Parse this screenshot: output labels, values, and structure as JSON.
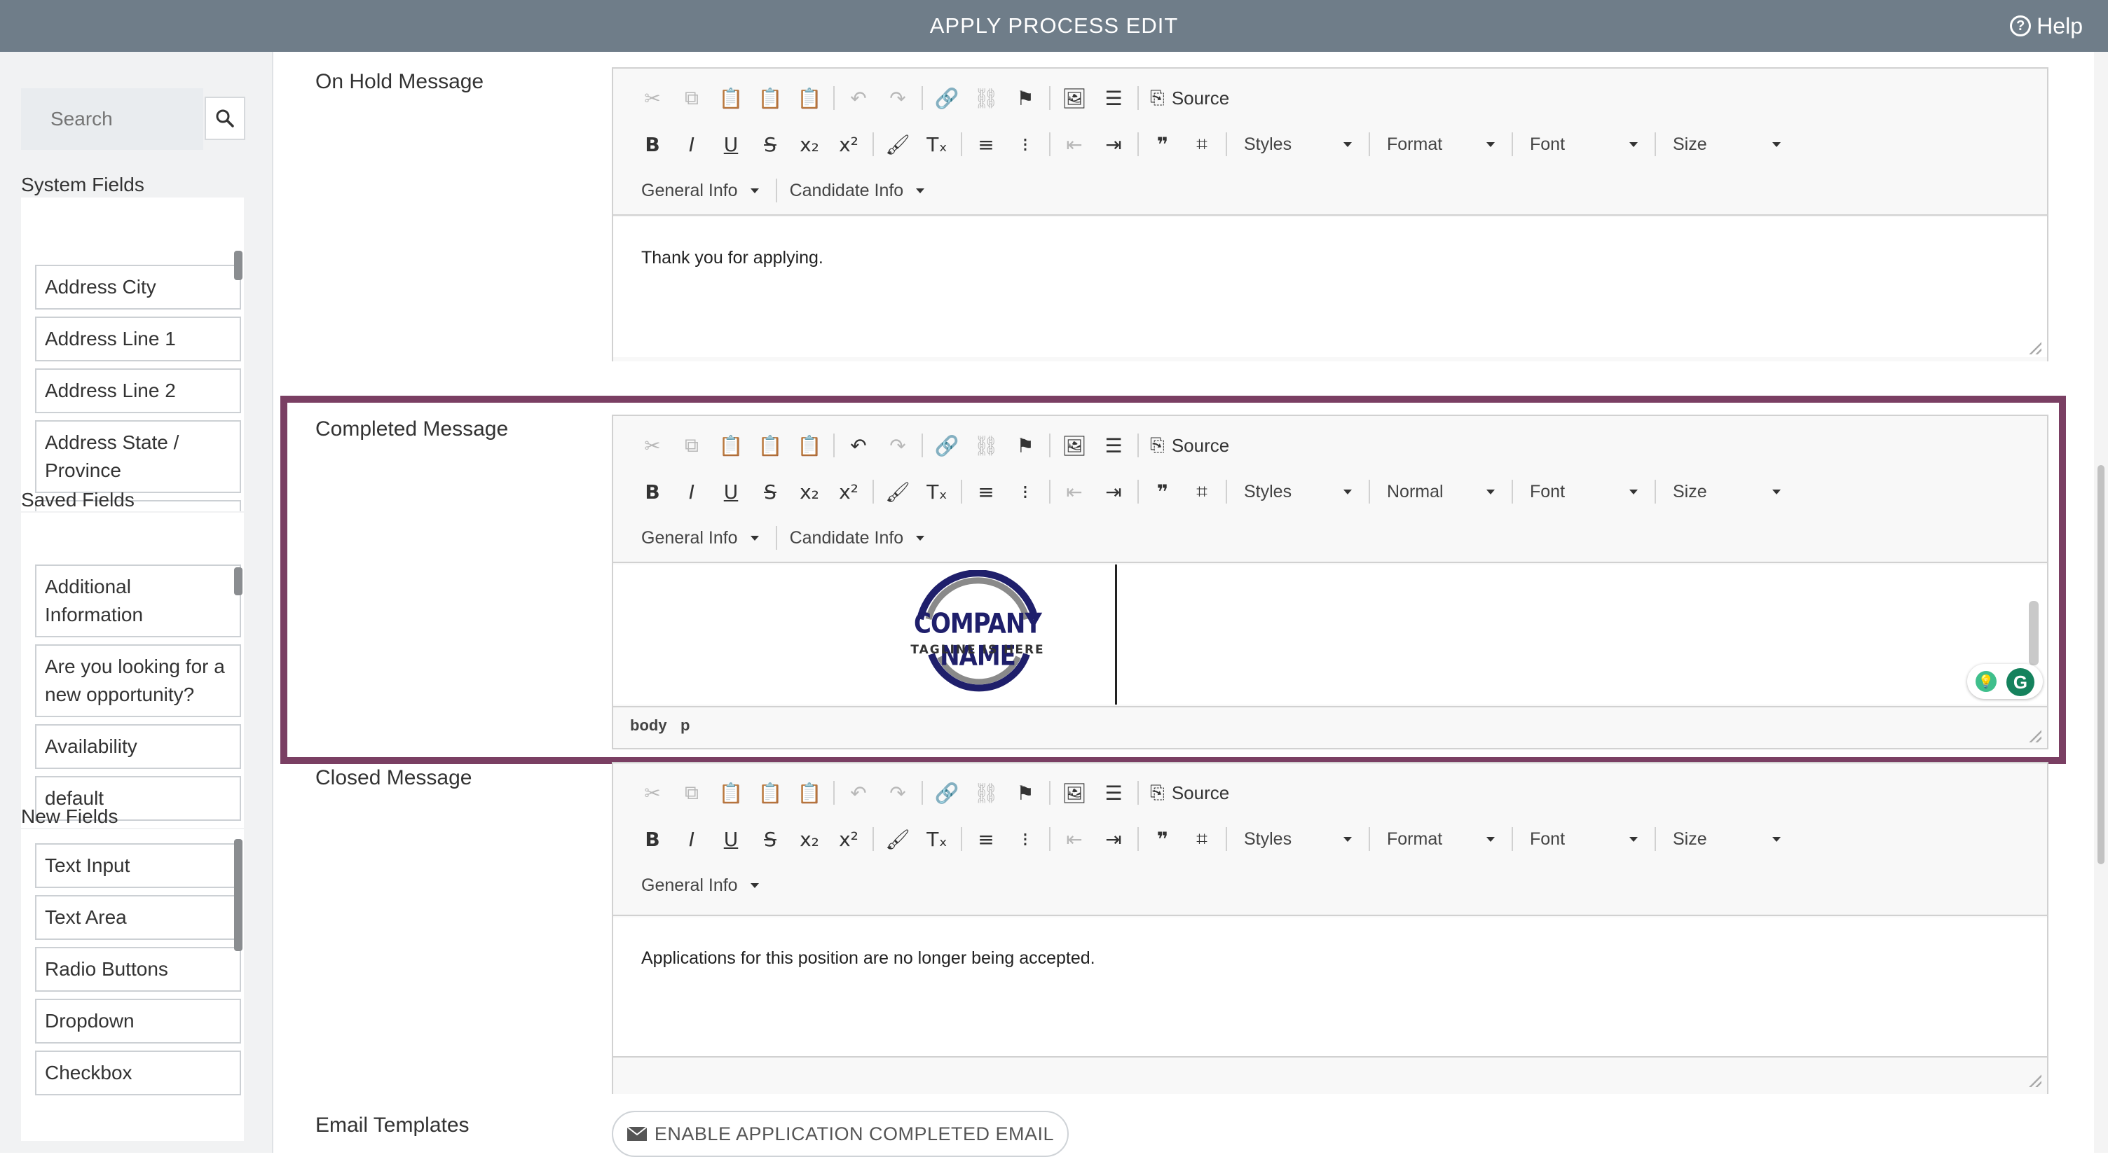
{
  "header": {
    "title": "APPLY PROCESS EDIT",
    "help_label": "Help"
  },
  "sidebar": {
    "search_placeholder": "Search",
    "system_fields": {
      "heading": "System Fields",
      "items": [
        "Address City",
        "Address Line 1",
        "Address Line 2",
        "Address State / Province"
      ]
    },
    "saved_fields": {
      "heading": "Saved Fields",
      "items": [
        "Additional Information",
        "Are you looking for a new opportunity?",
        "Availability",
        "default"
      ]
    },
    "new_fields": {
      "heading": "New Fields",
      "items": [
        "Text Input",
        "Text Area",
        "Radio Buttons",
        "Dropdown",
        "Checkbox"
      ]
    }
  },
  "editors": {
    "on_hold": {
      "label": "On Hold Message",
      "source_label": "Source",
      "dropdowns": [
        "Styles",
        "Format",
        "Font",
        "Size"
      ],
      "insert_menus": [
        "General Info",
        "Candidate Info"
      ],
      "content": "Thank you for applying."
    },
    "completed": {
      "label": "Completed Message",
      "source_label": "Source",
      "dropdowns": [
        "Styles",
        "Normal",
        "Font",
        "Size"
      ],
      "insert_menus": [
        "General Info",
        "Candidate Info"
      ],
      "logo": {
        "name": "COMPANY NAME",
        "tagline": "TAGLINE IS HERE"
      },
      "path": [
        "body",
        "p"
      ]
    },
    "closed": {
      "label": "Closed Message",
      "source_label": "Source",
      "dropdowns": [
        "Styles",
        "Format",
        "Font",
        "Size"
      ],
      "insert_menus": [
        "General Info"
      ],
      "content": "Applications for this position are no longer being accepted."
    }
  },
  "email_templates": {
    "label": "Email Templates",
    "button_label": "ENABLE APPLICATION COMPLETED EMAIL"
  },
  "colors": {
    "header_bg": "#6f7d89",
    "highlight": "#7a3f63",
    "logo_navy": "#1f1f6b",
    "logo_gray": "#8a8a8a"
  }
}
